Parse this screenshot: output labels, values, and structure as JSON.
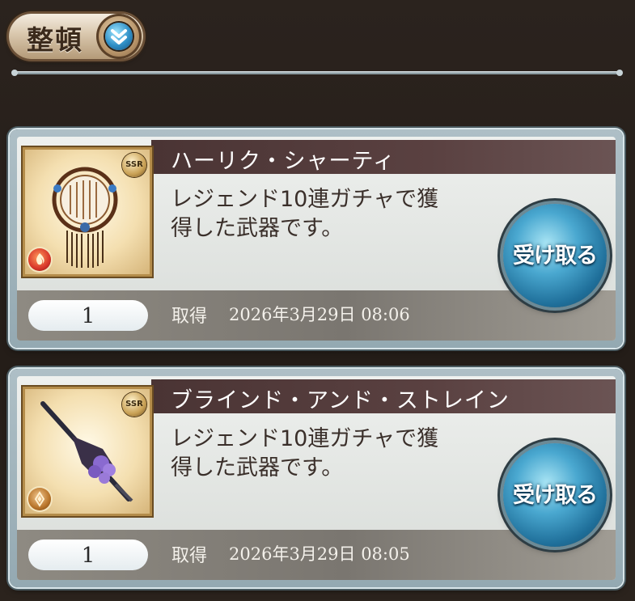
{
  "toolbar": {
    "sort_label": "整頓",
    "sort_icon": "chevron-double-down-icon"
  },
  "items": [
    {
      "name": "ハーリク・シャーティ",
      "description": "レジェンド10連ガチャで獲\n得した武器です。",
      "rarity": "SSR",
      "element": "fire",
      "quantity": "1",
      "acquired_label": "取得",
      "acquired_date": "2026年3月29日 08:06",
      "receive_label": "受け取る"
    },
    {
      "name": "ブラインド・アンド・ストレイン",
      "description": "レジェンド10連ガチャで獲\n得した武器です。",
      "rarity": "SSR",
      "element": "earth",
      "quantity": "1",
      "acquired_label": "取得",
      "acquired_date": "2026年3月29日 08:05",
      "receive_label": "受け取る"
    }
  ]
}
